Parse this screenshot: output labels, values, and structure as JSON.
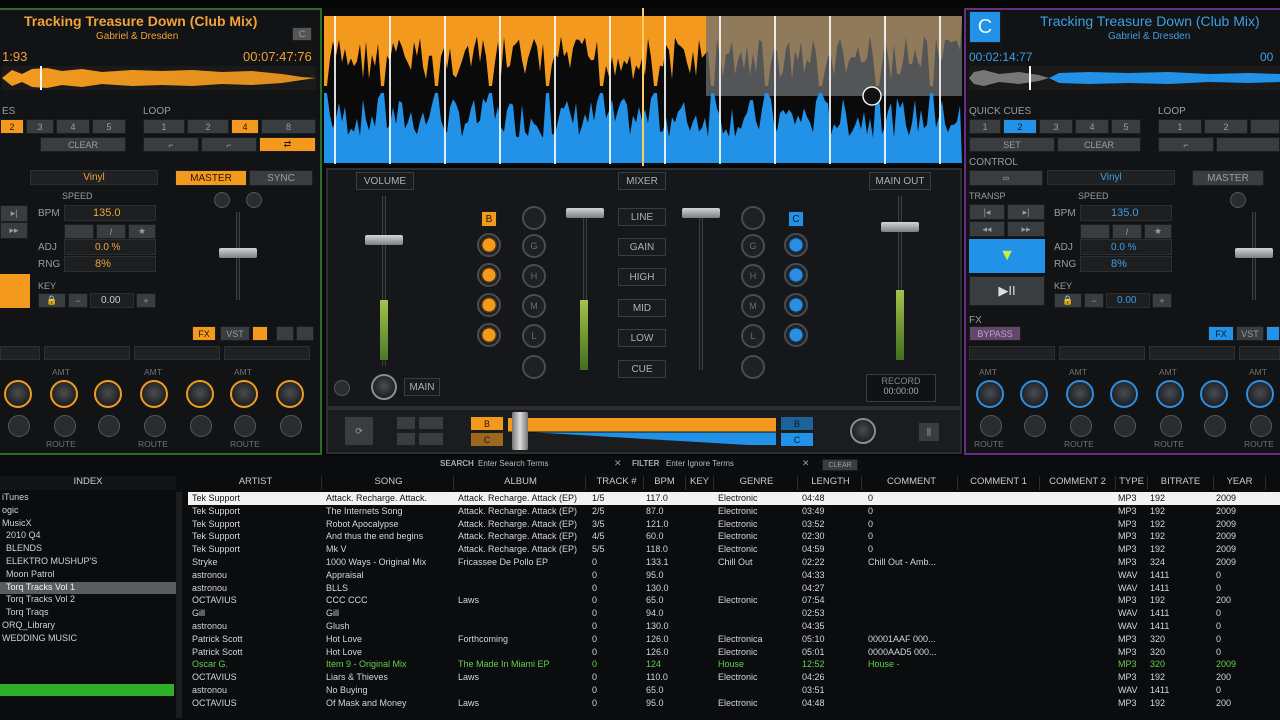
{
  "deckA": {
    "title": "Tracking Treasure Down (Club Mix)",
    "artist": "Gabriel & Dresden",
    "elapsed": "1:93",
    "remaining": "00:07:47:76",
    "deck_letter": "C",
    "cues_label": "ES",
    "cue_buttons": [
      "2",
      "3",
      "4",
      "5"
    ],
    "clear": "CLEAR",
    "loop_label": "LOOP",
    "loop_buttons": [
      "1",
      "2",
      "4",
      "8"
    ],
    "control_mode": "Vinyl",
    "master": "MASTER",
    "sync": "SYNC",
    "speed_label": "SPEED",
    "bpm_label": "BPM",
    "bpm": "135.0",
    "adj_label": "ADJ",
    "adj": "0.0 %",
    "rng_label": "RNG",
    "rng": "8%",
    "key_label": "KEY",
    "key": "0.00",
    "fx": "FX",
    "vst": "VST",
    "amt": "AMT",
    "route": "ROUTE"
  },
  "deckB": {
    "deck_letter": "C",
    "title": "Tracking Treasure Down (Club Mix)",
    "artist": "Gabriel & Dresden",
    "elapsed": "00:02:14:77",
    "remaining": "00",
    "quick_cues": "QUICK CUES",
    "cue_buttons": [
      "1",
      "2",
      "3",
      "4",
      "5"
    ],
    "set": "SET",
    "clear": "CLEAR",
    "loop_label": "LOOP",
    "loop_buttons": [
      "1",
      "2"
    ],
    "control_label": "CONTROL",
    "control_mode": "Vinyl",
    "master": "MASTER",
    "transp": "TRANSP",
    "speed_label": "SPEED",
    "bpm_label": "BPM",
    "bpm": "135.0",
    "adj_label": "ADJ",
    "adj": "0.0 %",
    "rng_label": "RNG",
    "rng": "8%",
    "key_label": "KEY",
    "key": "0.00",
    "fx": "FX",
    "bypass": "BYPASS",
    "fxbtn": "FX",
    "vst": "VST",
    "amt": "AMT",
    "route": "ROUTE"
  },
  "mixer": {
    "volume": "VOLUME",
    "mixer": "MIXER",
    "main_out": "MAIN OUT",
    "bands": [
      "LINE",
      "GAIN",
      "HIGH",
      "MID",
      "LOW",
      "CUE"
    ],
    "left_tag": "B",
    "right_tag": "C",
    "eq_letters": [
      "G",
      "H",
      "M",
      "L"
    ],
    "main": "MAIN",
    "record": "RECORD",
    "record_time": "00:00:00",
    "xf_left": [
      "B",
      "C"
    ],
    "xf_right": [
      "B",
      "C"
    ]
  },
  "search": {
    "search_label": "SEARCH",
    "search_placeholder": "Enter Search Terms",
    "filter_label": "FILTER",
    "filter_placeholder": "Enter Ignore Terms",
    "clear": "CLEAR"
  },
  "index": {
    "header": "INDEX",
    "items": [
      "iTunes",
      "ogic",
      "MusicX",
      "2010 Q4",
      "BLENDS",
      "ELEKTRO MUSHUP'S",
      "Moon Patrol",
      "Torq Tracks Vol 1",
      "Torq Tracks Vol 2",
      "Torq Traqs",
      "ORQ_Library",
      "WEDDING MUSIC"
    ]
  },
  "table": {
    "headers": [
      "ARTIST",
      "SONG",
      "ALBUM",
      "TRACK #",
      "BPM",
      "KEY",
      "GENRE",
      "LENGTH",
      "COMMENT",
      "COMMENT 1",
      "COMMENT 2",
      "TYPE",
      "BITRATE",
      "YEAR"
    ],
    "rows": [
      [
        "Tek Support",
        "Attack. Recharge. Attack.",
        "Attack. Recharge. Attack (EP)",
        "1/5",
        "117.0",
        "",
        "Electronic",
        "04:48",
        "0",
        "",
        "",
        "MP3",
        "192",
        "2009"
      ],
      [
        "Tek Support",
        "The Internets Song",
        "Attack. Recharge. Attack (EP)",
        "2/5",
        "87.0",
        "",
        "Electronic",
        "03:49",
        "0",
        "",
        "",
        "MP3",
        "192",
        "2009"
      ],
      [
        "Tek Support",
        "Robot Apocalypse",
        "Attack. Recharge. Attack (EP)",
        "3/5",
        "121.0",
        "",
        "Electronic",
        "03:52",
        "0",
        "",
        "",
        "MP3",
        "192",
        "2009"
      ],
      [
        "Tek Support",
        "And thus the end begins",
        "Attack. Recharge. Attack (EP)",
        "4/5",
        "60.0",
        "",
        "Electronic",
        "02:30",
        "0",
        "",
        "",
        "MP3",
        "192",
        "2009"
      ],
      [
        "Tek Support",
        "Mk V",
        "Attack. Recharge. Attack (EP)",
        "5/5",
        "118.0",
        "",
        "Electronic",
        "04:59",
        "0",
        "",
        "",
        "MP3",
        "192",
        "2009"
      ],
      [
        "Stryke",
        "1000 Ways - Original Mix",
        "Fricassee De Pollo EP",
        "0",
        "133.1",
        "",
        "Chill Out",
        "02:22",
        "Chill Out - Amb...",
        "",
        "",
        "MP3",
        "324",
        "2009"
      ],
      [
        "astronou",
        "Appraisal",
        "",
        "0",
        "95.0",
        "",
        "",
        "04:33",
        "",
        "",
        "",
        "WAV",
        "1411",
        "0"
      ],
      [
        "astronou",
        "BLLS",
        "",
        "0",
        "130.0",
        "",
        "",
        "04:27",
        "",
        "",
        "",
        "WAV",
        "1411",
        "0"
      ],
      [
        "OCTAVIUS",
        "CCC CCC",
        "Laws",
        "0",
        "65.0",
        "",
        "Electronic",
        "07:54",
        "",
        "",
        "",
        "MP3",
        "192",
        "200"
      ],
      [
        "Gill",
        "Gill",
        "",
        "0",
        "94.0",
        "",
        "",
        "02:53",
        "",
        "",
        "",
        "WAV",
        "1411",
        "0"
      ],
      [
        "astronou",
        "Glush",
        "",
        "0",
        "130.0",
        "",
        "",
        "04:35",
        "",
        "",
        "",
        "WAV",
        "1411",
        "0"
      ],
      [
        "Patrick Scott",
        "Hot Love",
        "Forthcoming",
        "0",
        "126.0",
        "",
        "Electronica",
        "05:10",
        "00001AAF 000...",
        "",
        "",
        "MP3",
        "320",
        "0"
      ],
      [
        "Patrick Scott",
        "Hot Love",
        "",
        "0",
        "126.0",
        "",
        "Electronic",
        "05:01",
        "0000AAD5 000...",
        "",
        "",
        "MP3",
        "320",
        "0"
      ],
      [
        "Oscar G.",
        "Item 9 - Original Mix",
        "The Made In Miami EP",
        "0",
        "124",
        "",
        "House",
        "12:52",
        "House -",
        "",
        "",
        "MP3",
        "320",
        "2009"
      ],
      [
        "OCTAVIUS",
        "Liars & Thieves",
        "Laws",
        "0",
        "110.0",
        "",
        "Electronic",
        "04:26",
        "",
        "",
        "",
        "MP3",
        "192",
        "200"
      ],
      [
        "astronou",
        "No Buying",
        "",
        "0",
        "65.0",
        "",
        "",
        "03:51",
        "",
        "",
        "",
        "WAV",
        "1411",
        "0"
      ],
      [
        "OCTAVIUS",
        "Of Mask and Money",
        "Laws",
        "0",
        "95.0",
        "",
        "Electronic",
        "04:48",
        "",
        "",
        "",
        "MP3",
        "192",
        "200"
      ]
    ]
  },
  "colors": {
    "orange": "#f39a1e",
    "blue": "#2192e8",
    "purple": "#8a3fa0",
    "green": "#3fae2a"
  }
}
